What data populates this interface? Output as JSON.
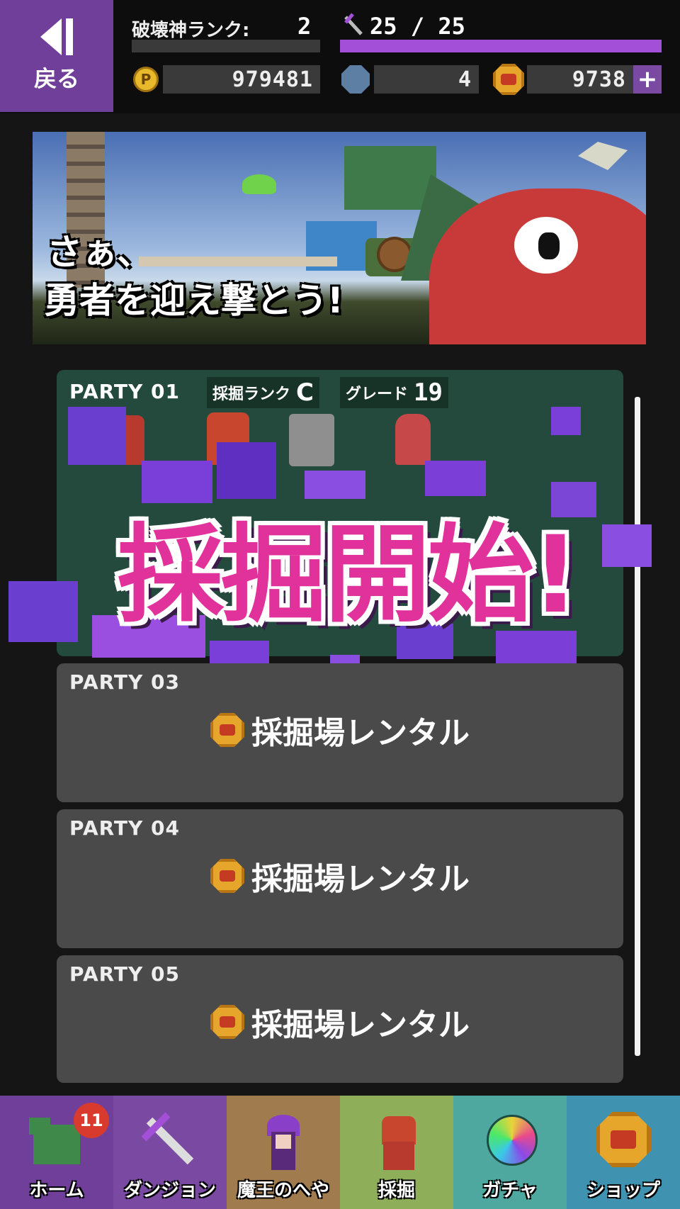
{
  "header": {
    "back_label": "戻る",
    "rank_label": "破壊神ランク:",
    "rank_value": "2",
    "stamina_text": "25 / 25",
    "stamina_fraction": 1.0,
    "points_value": "979481",
    "gem_value": "4",
    "medal_value": "9738",
    "colors": {
      "accent": "#6f3f9a",
      "stamina_bar": "#a34fd8"
    }
  },
  "banner": {
    "line1": "さぁ、",
    "line2": "勇者を迎え撃とう!"
  },
  "party1": {
    "title": "PARTY 01",
    "dig_rank_label": "採掘ランク",
    "dig_rank_value": "C",
    "grade_label": "グレード",
    "grade_value": "19"
  },
  "overlay_text": "採掘開始!",
  "parties": [
    {
      "title": "PARTY 03",
      "action": "採掘場レンタル"
    },
    {
      "title": "PARTY 04",
      "action": "採掘場レンタル"
    },
    {
      "title": "PARTY 05",
      "action": "採掘場レンタル"
    }
  ],
  "nav": [
    {
      "label": "ホーム",
      "badge": "11",
      "icon": "dragon-icon",
      "bg": "#6f3f9a"
    },
    {
      "label": "ダンジョン",
      "icon": "pickaxe-icon",
      "bg": "#7a4aa3"
    },
    {
      "label": "魔王のへや",
      "icon": "demon-lord-icon",
      "bg": "#a07b4e"
    },
    {
      "label": "採掘",
      "icon": "miner-icon",
      "bg": "#8fae5a"
    },
    {
      "label": "ガチャ",
      "icon": "gacha-orb-icon",
      "bg": "#4fa8a0"
    },
    {
      "label": "ショップ",
      "icon": "medal-icon",
      "bg": "#3f93b0"
    }
  ]
}
